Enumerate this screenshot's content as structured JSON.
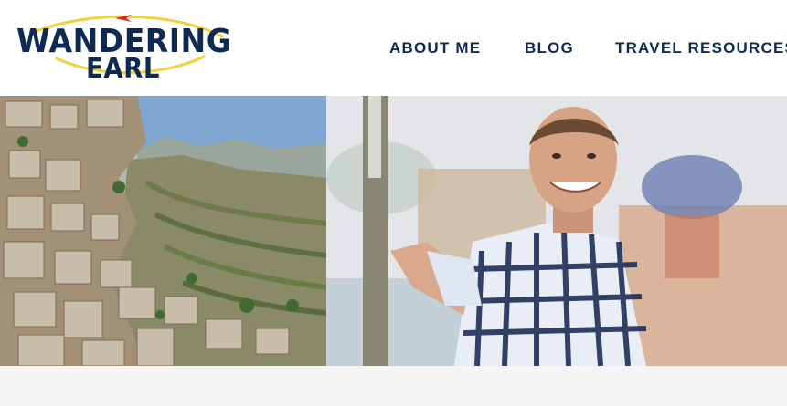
{
  "site": {
    "logo": {
      "line1": "WANDERING",
      "line2": "EARL"
    }
  },
  "nav": {
    "items": [
      {
        "label": "ABOUT ME"
      },
      {
        "label": "BLOG"
      },
      {
        "label": "TRAVEL RESOURCES"
      }
    ]
  },
  "hero": {
    "left_image": "mountain-village-photo",
    "right_image": "man-smiling-by-pole-photo"
  },
  "colors": {
    "brand_navy": "#0f2a52",
    "swoosh_yellow": "#f2d23a",
    "plane_red": "#d8242a",
    "header_bg": "#ffffff",
    "page_bg": "#f4f4f4"
  }
}
